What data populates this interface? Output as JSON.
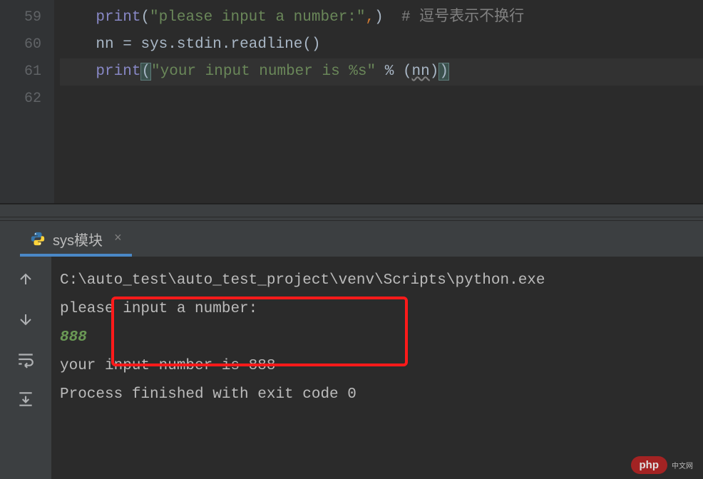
{
  "editor": {
    "lines": [
      {
        "num": "59"
      },
      {
        "num": "60"
      },
      {
        "num": "61"
      },
      {
        "num": "62"
      }
    ],
    "code": {
      "l59": {
        "indent": "    ",
        "fn": "print",
        "p1": "(",
        "str": "\"please input a number:\"",
        "comma": ",",
        "p2": ")",
        "sp": "  ",
        "hash": "#",
        "comment": " 逗号表示不换行"
      },
      "l60": {
        "indent": "    ",
        "v": "nn",
        "sp1": " ",
        "eq": "=",
        "sp2": " ",
        "sys": "sys",
        "d1": ".",
        "stdin": "stdin",
        "d2": ".",
        "readline": "readline",
        "p1": "(",
        "p2": ")"
      },
      "l61": {
        "indent": "    ",
        "fn": "print",
        "p1": "(",
        "str": "\"your input number is %s\"",
        "sp1": " ",
        "pct": "%",
        "sp2": " ",
        "p2": "(",
        "nn": "nn",
        "p3": ")",
        "p4": ")"
      }
    }
  },
  "tab": {
    "label": "sys模块",
    "close": "×"
  },
  "console": {
    "l1": "C:\\auto_test\\auto_test_project\\venv\\Scripts\\python.exe ",
    "l2": "please input a number:",
    "l3": "888",
    "l4": "your input number is 888",
    "l5": "",
    "l6": "Process finished with exit code 0"
  },
  "watermark": {
    "text": "php",
    "sub": "中文网"
  }
}
